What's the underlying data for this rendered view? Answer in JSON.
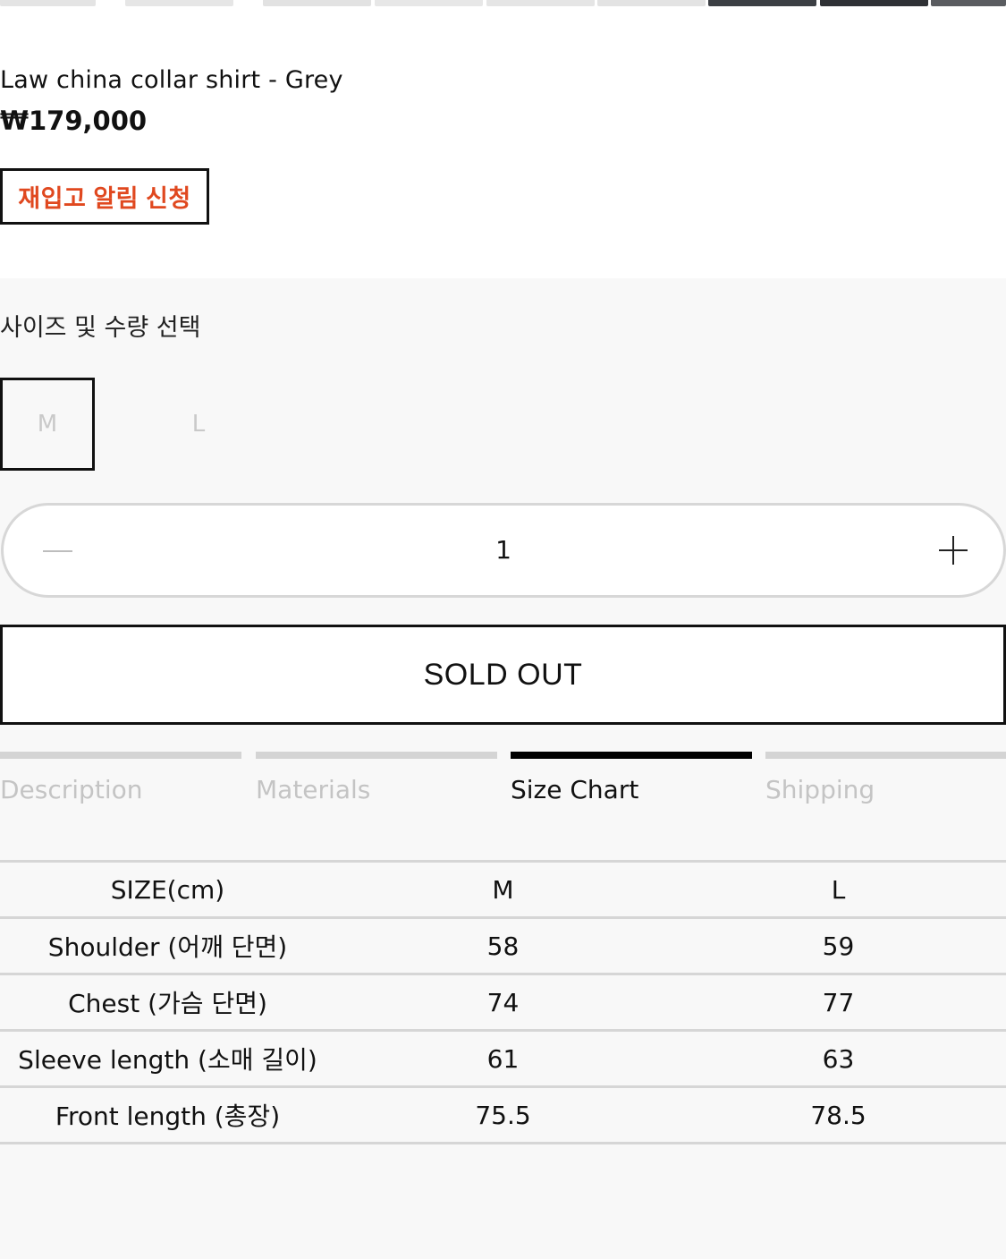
{
  "product": {
    "title": "Law china collar shirt - Grey",
    "price": "₩179,000",
    "restock_label": "재입고 알림 신청"
  },
  "options": {
    "label": "사이즈 및 수량 선택",
    "sizes": [
      "M",
      "L"
    ],
    "selected_size": "M",
    "quantity": "1"
  },
  "purchase": {
    "sold_out_label": "SOLD OUT"
  },
  "tabs": [
    {
      "label": "Description",
      "active": false
    },
    {
      "label": "Materials",
      "active": false
    },
    {
      "label": "Size Chart",
      "active": true
    },
    {
      "label": "Shipping",
      "active": false
    }
  ],
  "size_chart": {
    "header": [
      "SIZE(cm)",
      "M",
      "L"
    ],
    "rows": [
      [
        "Shoulder (어깨 단면)",
        "58",
        "59"
      ],
      [
        "Chest (가슴 단면)",
        "74",
        "77"
      ],
      [
        "Sleeve length (소매 길이)",
        "61",
        "63"
      ],
      [
        "Front length (총장)",
        "75.5",
        "78.5"
      ]
    ]
  },
  "colors": {
    "accent": "#e0481f",
    "border": "#111111",
    "panel": "#f8f8f8"
  }
}
